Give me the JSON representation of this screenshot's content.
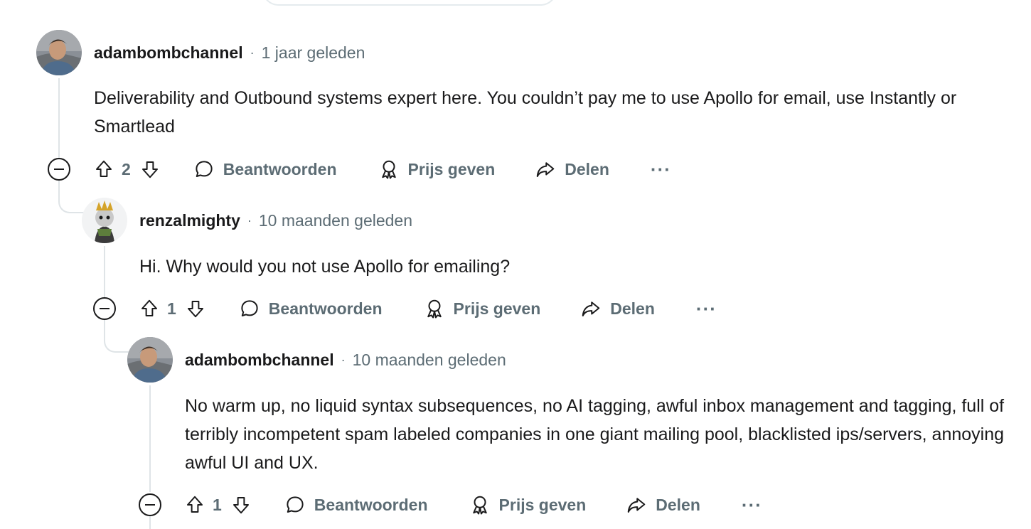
{
  "comments": [
    {
      "username": "adambombchannel",
      "time": "1 jaar geleden",
      "body": "Deliverability and Outbound systems expert here. You couldn’t pay me to use Apollo for email, use Instantly or Smartlead",
      "score": "2",
      "reply_label": "Beantwoorden",
      "award_label": "Prijs geven",
      "share_label": "Delen",
      "more_label": "···"
    },
    {
      "username": "renzalmighty",
      "time": "10 maanden geleden",
      "body": "Hi. Why would you not use Apollo for emailing?",
      "score": "1",
      "reply_label": "Beantwoorden",
      "award_label": "Prijs geven",
      "share_label": "Delen",
      "more_label": "···"
    },
    {
      "username": "adambombchannel",
      "time": "10 maanden geleden",
      "body": "No warm up, no liquid syntax subsequences, no AI tagging, awful inbox management and tagging, full of terribly incompetent spam labeled companies in one giant mailing pool, blacklisted ips/servers, annoying awful UI and UX.",
      "score": "1",
      "reply_label": "Beantwoorden",
      "award_label": "Prijs geven",
      "share_label": "Delen",
      "more_label": "···"
    }
  ],
  "meta_separator": "·",
  "colors": {
    "text": "#1a1a1b",
    "muted": "#5c6c74",
    "thread_line": "#dfe4e7"
  },
  "icons": {
    "upvote": "arrow-up-icon",
    "downvote": "arrow-down-icon",
    "reply": "comment-bubble-icon",
    "award": "award-icon",
    "share": "share-arrow-icon",
    "collapse": "minus-circle-icon",
    "more": "ellipsis-icon"
  }
}
